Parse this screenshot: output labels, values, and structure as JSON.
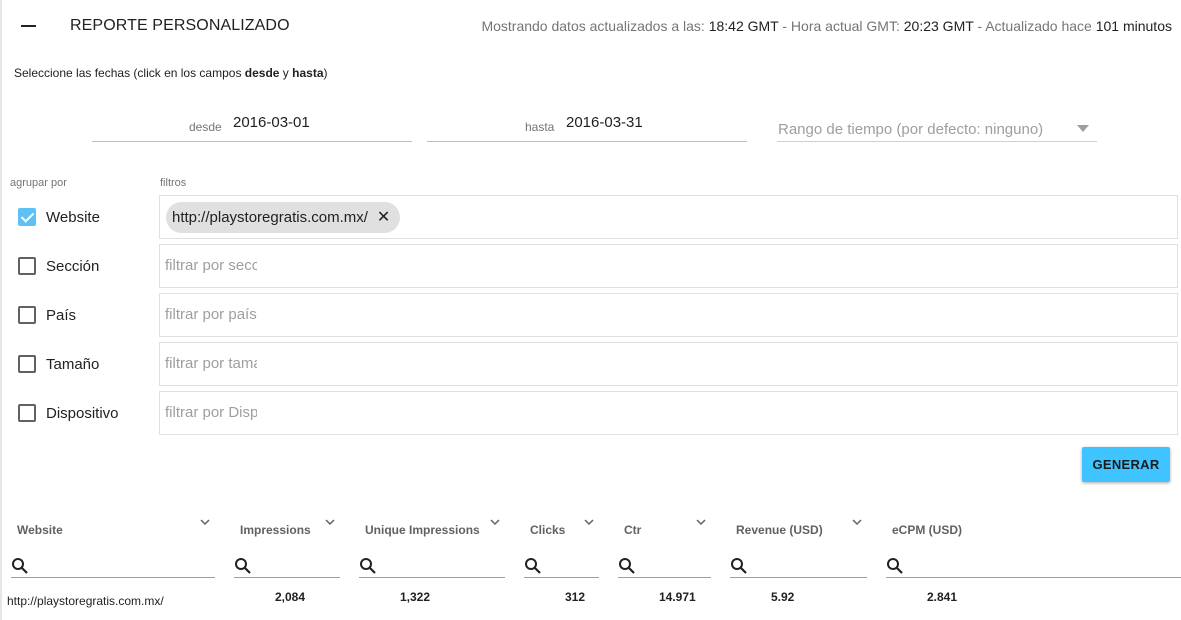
{
  "header": {
    "title": "REPORTE PERSONALIZADO",
    "status_prefix1": "Mostrando datos actualizados a las: ",
    "updated_time": "18:42 GMT",
    "status_prefix2": " - Hora actual GMT: ",
    "current_time": "20:23 GMT",
    "status_prefix3": " - Actualizado hace ",
    "minutes_ago": "101 minutos"
  },
  "instructions": {
    "part1": "Seleccione las fechas (click en los campos ",
    "bold1": "desde",
    "part2": " y ",
    "bold2": "hasta",
    "part3": ")"
  },
  "dates": {
    "from_label": "desde",
    "from_value": "2016-03-01",
    "to_label": "hasta",
    "to_value": "2016-03-31",
    "range_placeholder": "Rango de tiempo (por defecto: ninguno)"
  },
  "grouping": {
    "group_label": "agrupar por",
    "filters_label": "filtros",
    "rows": [
      {
        "label": "Website",
        "checked": true,
        "chip": "http://playstoregratis.com.mx/"
      },
      {
        "label": "Sección",
        "checked": false,
        "placeholder": "filtrar por sección"
      },
      {
        "label": "País",
        "checked": false,
        "placeholder": "filtrar por país"
      },
      {
        "label": "Tamaño",
        "checked": false,
        "placeholder": "filtrar por tamaño"
      },
      {
        "label": "Dispositivo",
        "checked": false,
        "placeholder": "filtrar por Dispositivo"
      }
    ]
  },
  "generate_label": "GENERAR",
  "table": {
    "columns": [
      "Website",
      "Impressions",
      "Unique Impressions",
      "Clicks",
      "Ctr",
      "Revenue (USD)",
      "eCPM (USD)"
    ],
    "rows": [
      {
        "website": "http://playstoregratis.com.mx/",
        "impressions": "2,084",
        "unique_impressions": "1,322",
        "clicks": "312",
        "ctr": "14.971",
        "revenue": "5.92",
        "ecpm": "2.841"
      }
    ]
  },
  "colors": {
    "accent": "#40c4ff",
    "checkbox_checked": "#5ec1f5",
    "chip_bg": "#e0e0e0"
  }
}
